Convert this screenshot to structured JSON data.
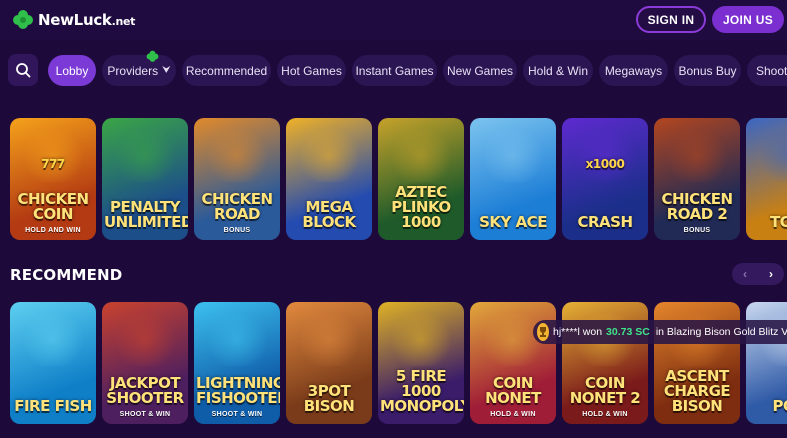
{
  "header": {
    "logo_name": "NewLuck",
    "logo_tld": ".net",
    "signin_label": "SIGN IN",
    "join_label": "JOIN US",
    "accent": "#7b2fd0"
  },
  "filters": {
    "search_icon": "search-icon",
    "chips": [
      {
        "label": "Lobby",
        "active": true
      },
      {
        "label": "Providers",
        "caret": "⮟"
      },
      {
        "label": "Recommended"
      },
      {
        "label": "Hot Games"
      },
      {
        "label": "Instant Games"
      },
      {
        "label": "New Games"
      },
      {
        "label": "Hold & Win"
      },
      {
        "label": "Megaways"
      },
      {
        "label": "Bonus Buy"
      },
      {
        "label": "Shooti"
      }
    ]
  },
  "top_games": [
    {
      "title": "CHICKEN COIN",
      "sub": "HOLD AND WIN",
      "badge": "777",
      "colors": [
        "#b33a12",
        "#f5a21b"
      ]
    },
    {
      "title": "PENALTY UNLIMITED",
      "sub": "",
      "colors": [
        "#1c4e8a",
        "#3aa545"
      ]
    },
    {
      "title": "CHICKEN ROAD",
      "sub": "BONUS",
      "colors": [
        "#2a5a9a",
        "#e28a2a"
      ]
    },
    {
      "title": "MEGA BLOCK",
      "sub": "",
      "colors": [
        "#234bb0",
        "#f0b126"
      ]
    },
    {
      "title": "AZTEC PLINKO 1000",
      "sub": "",
      "colors": [
        "#1f5b2a",
        "#c7a22a"
      ]
    },
    {
      "title": "SKY ACE",
      "sub": "",
      "colors": [
        "#1d7ed6",
        "#7cc4ef"
      ]
    },
    {
      "title": "CRASH",
      "sub": "",
      "badge": "x1000",
      "colors": [
        "#1b2f8a",
        "#5e2ad0"
      ]
    },
    {
      "title": "CHICKEN ROAD 2",
      "sub": "BONUS",
      "colors": [
        "#202a55",
        "#b3461f"
      ]
    },
    {
      "title": "TOW",
      "sub": "",
      "colors": [
        "#c98012",
        "#3a66c4"
      ]
    }
  ],
  "recommend": {
    "title": "RECOMMEND",
    "prev_icon": "‹",
    "next_icon": "›"
  },
  "rec_games": [
    {
      "title": "FIRE FISH",
      "sub": "",
      "colors": [
        "#0f7fc8",
        "#5ed0f0"
      ]
    },
    {
      "title": "JACKPOT SHOOTER",
      "sub": "SHOOT & WIN",
      "colors": [
        "#4d1f5f",
        "#c9422e"
      ]
    },
    {
      "title": "LIGHTNING FISHOOTER",
      "sub": "SHOOT & WIN",
      "colors": [
        "#0f5ca8",
        "#3dc1ef"
      ]
    },
    {
      "title": "3POT BISON",
      "sub": "",
      "colors": [
        "#7a3b1a",
        "#e28a3e"
      ]
    },
    {
      "title": "5 FIRE 1000 MONOPOLY",
      "sub": "",
      "colors": [
        "#3a1c6a",
        "#e0b224"
      ]
    },
    {
      "title": "COIN NONET",
      "sub": "HOLD & WIN",
      "colors": [
        "#a01d37",
        "#e2a83a"
      ]
    },
    {
      "title": "COIN NONET 2",
      "sub": "HOLD & WIN",
      "colors": [
        "#7a1a1a",
        "#e6b135"
      ]
    },
    {
      "title": "ASCENT CHARGE BISON",
      "sub": "",
      "colors": [
        "#7e2d10",
        "#e5862c"
      ]
    },
    {
      "title": "POS",
      "sub": "",
      "colors": [
        "#2f5aa6",
        "#c9d8f0"
      ]
    }
  ],
  "ticker": {
    "user": "hj****l won",
    "amount": "30.73 SC",
    "game": "in Blazing Bison Gold Blitz VF"
  }
}
